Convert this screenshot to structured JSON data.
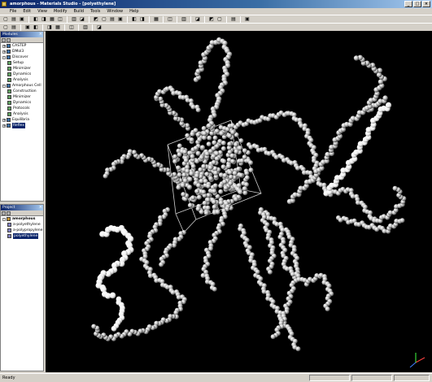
{
  "window": {
    "title": "amorphous - Materials Studio - [polyethylene]"
  },
  "menu": [
    {
      "label": "File"
    },
    {
      "label": "Edit"
    },
    {
      "label": "View"
    },
    {
      "label": "Modify"
    },
    {
      "label": "Build"
    },
    {
      "label": "Tools"
    },
    {
      "label": "Window"
    },
    {
      "label": "Help"
    }
  ],
  "modules_panel": {
    "title": "Modules",
    "items": [
      {
        "label": "CASTEP",
        "level": 0,
        "expander": "+",
        "icon": "module-icon"
      },
      {
        "label": "DMol3",
        "level": 0,
        "expander": "+",
        "icon": "module-icon"
      },
      {
        "label": "Discover",
        "level": 0,
        "expander": "-",
        "icon": "module-icon"
      },
      {
        "label": "Setup",
        "level": 1,
        "expander": "",
        "icon": "tool-icon"
      },
      {
        "label": "Minimizer",
        "level": 1,
        "expander": "",
        "icon": "tool-icon"
      },
      {
        "label": "Dynamics",
        "level": 1,
        "expander": "",
        "icon": "tool-icon"
      },
      {
        "label": "Analysis",
        "level": 1,
        "expander": "",
        "icon": "tool-icon"
      },
      {
        "label": "Amorphous Cell",
        "level": 0,
        "expander": "-",
        "icon": "module-icon"
      },
      {
        "label": "Construction",
        "level": 1,
        "expander": "",
        "icon": "tool-icon"
      },
      {
        "label": "Minimizer",
        "level": 1,
        "expander": "",
        "icon": "tool-icon"
      },
      {
        "label": "Dynamics",
        "level": 1,
        "expander": "",
        "icon": "tool-icon"
      },
      {
        "label": "Protocols",
        "level": 1,
        "expander": "",
        "icon": "tool-icon"
      },
      {
        "label": "Analysis",
        "level": 1,
        "expander": "",
        "icon": "tool-icon"
      },
      {
        "label": "Equilibria",
        "level": 0,
        "expander": "+",
        "icon": "module-icon"
      },
      {
        "label": "Reflex",
        "level": 0,
        "expander": "+",
        "icon": "module-icon",
        "selected": true
      }
    ]
  },
  "project_panel": {
    "title": "Project",
    "items": [
      {
        "label": "amorphous",
        "level": 0,
        "expander": "-",
        "icon": "project-icon",
        "bold": true
      },
      {
        "label": "a-polyethylene",
        "level": 1,
        "expander": "",
        "icon": "doc-icon"
      },
      {
        "label": "a-polypropylene",
        "level": 1,
        "expander": "",
        "icon": "doc-icon"
      },
      {
        "label": "polyethylene",
        "level": 1,
        "expander": "",
        "icon": "doc-icon",
        "selected": true
      }
    ]
  },
  "toolbar_icons": {
    "row1": [
      "new-icon",
      "open-icon",
      "save-icon",
      "sep",
      "cut-icon",
      "copy-icon",
      "paste-icon",
      "delete-icon",
      "sep",
      "undo-icon",
      "redo-icon",
      "sep",
      "select-icon",
      "rotate-icon",
      "translate-icon",
      "zoom-icon",
      "sep",
      "fit-icon",
      "reset-icon",
      "sep",
      "color-icon",
      "sep",
      "label-icon",
      "sep",
      "measure-icon",
      "sep",
      "display-style-icon",
      "sep",
      "grid-icon",
      "symmetry-icon",
      "sep",
      "atom-icon",
      "sep",
      "help-icon"
    ],
    "row2": [
      "build-icon",
      "sketch-icon",
      "sep",
      "ring-icon",
      "bond-icon",
      "sep",
      "hydrogen-icon",
      "clean-icon",
      "sep",
      "crystal-icon",
      "sep",
      "lattice-icon",
      "sep",
      "cell-icon"
    ]
  },
  "viewport": {
    "background_color": "#000000",
    "bead_color": "#c8c8c8",
    "cell_color": "#e0e0e0",
    "axes": {
      "x": "",
      "y": "",
      "z": ""
    }
  },
  "status": {
    "text": "Ready"
  }
}
